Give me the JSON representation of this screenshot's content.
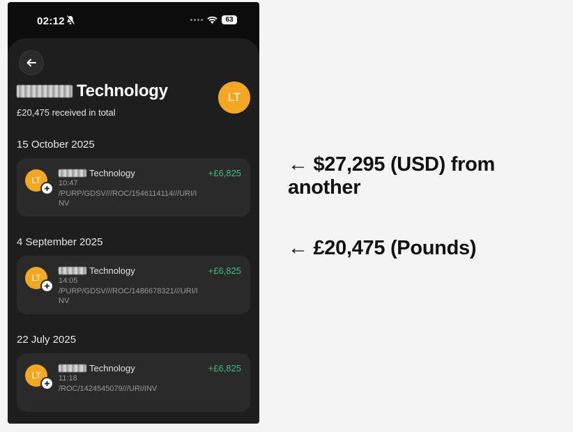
{
  "status_bar": {
    "time": "02:12",
    "battery": "63",
    "icons": [
      "bell-slash-icon",
      "signal-dots-icon",
      "wifi-icon",
      "battery-icon"
    ]
  },
  "header": {
    "back_icon": "arrow-left-icon",
    "title": "Technology",
    "subtitle": "£20,475 received in total",
    "avatar_initials": "LT",
    "avatar_color": "#f5a623"
  },
  "groups": [
    {
      "date": "15 October 2025",
      "transaction": {
        "initials": "LT",
        "name": "Technology",
        "time": "10:47",
        "reference": "/PURP/GDSV///ROC/1546114114///URI/I NV",
        "amount": "+£6,825"
      }
    },
    {
      "date": "4 September 2025",
      "transaction": {
        "initials": "LT",
        "name": "Technology",
        "time": "14:05",
        "reference": "/PURP/GDSV///ROC/1486678321///URI/I NV",
        "amount": "+£6,825"
      }
    },
    {
      "date": "22 July 2025",
      "transaction": {
        "initials": "LT",
        "name": "Technology",
        "time": "11:18",
        "reference": "/ROC/1424545079///URI/INV",
        "amount": "+£6,825"
      }
    }
  ],
  "annotations": {
    "first": "← $27,295 (USD) from another",
    "second": "← £20,475 (Pounds)"
  },
  "colors": {
    "amount_positive": "#3dbf7a",
    "sheet_background": "#1e1e1f",
    "card_background": "#2a2a2b"
  }
}
